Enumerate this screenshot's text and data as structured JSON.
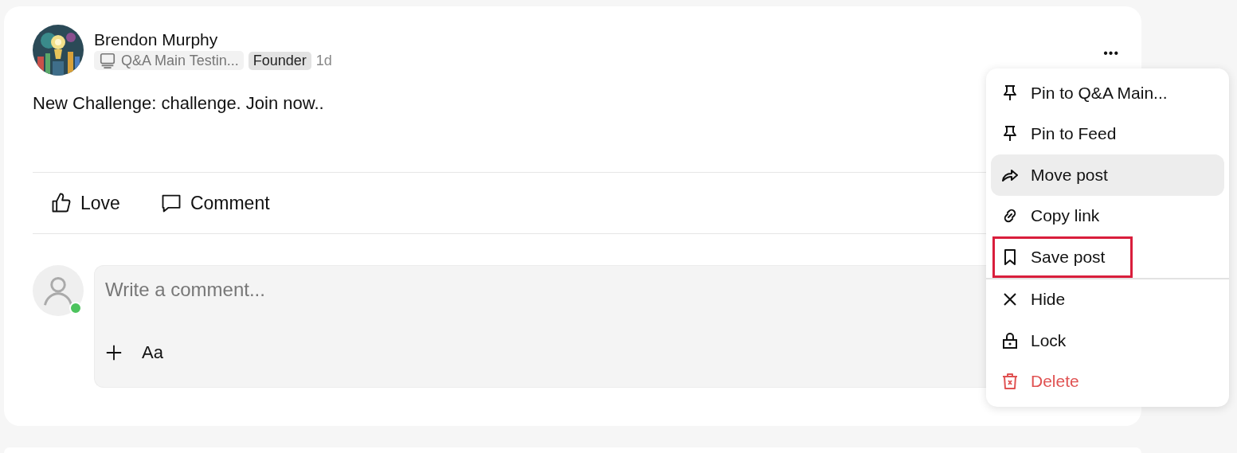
{
  "post": {
    "author": "Brendon Murphy",
    "space": "Q&A Main Testin...",
    "role_badge": "Founder",
    "time": "1d",
    "body": "New Challenge: challenge. Join now..",
    "more_button": "•••",
    "actions": [
      {
        "kind": "like",
        "label": "Love"
      },
      {
        "kind": "comment",
        "label": "Comment"
      }
    ],
    "comment_box": {
      "placeholder": "Write a comment...",
      "online": true,
      "tools": [
        {
          "kind": "plus"
        },
        {
          "kind": "text",
          "label": "Aa"
        }
      ]
    }
  },
  "menu": {
    "items": [
      {
        "kind": "pin",
        "label": "Pin to Q&A Main...",
        "hovered": false,
        "highlighted": false,
        "danger": false,
        "separator_after": false
      },
      {
        "kind": "pin",
        "label": "Pin to Feed",
        "hovered": false,
        "highlighted": false,
        "danger": false,
        "separator_after": false
      },
      {
        "kind": "share",
        "label": "Move post",
        "hovered": true,
        "highlighted": false,
        "danger": false,
        "separator_after": false
      },
      {
        "kind": "link",
        "label": "Copy link",
        "hovered": false,
        "highlighted": false,
        "danger": false,
        "separator_after": false
      },
      {
        "kind": "bookmark",
        "label": "Save post",
        "hovered": false,
        "highlighted": true,
        "danger": false,
        "separator_after": true
      },
      {
        "kind": "close",
        "label": "Hide",
        "hovered": false,
        "highlighted": false,
        "danger": false,
        "separator_after": false
      },
      {
        "kind": "lock",
        "label": "Lock",
        "hovered": false,
        "highlighted": false,
        "danger": false,
        "separator_after": false
      },
      {
        "kind": "trash",
        "label": "Delete",
        "hovered": false,
        "highlighted": false,
        "danger": true,
        "separator_after": false
      }
    ]
  }
}
